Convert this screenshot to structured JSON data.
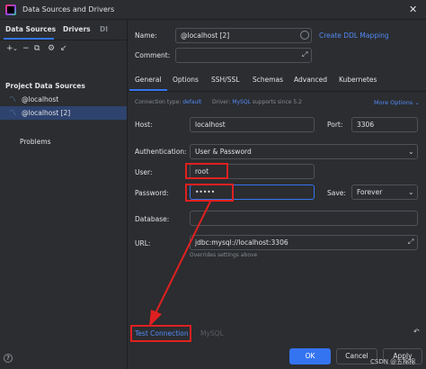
{
  "window": {
    "title": "Data Sources and Drivers",
    "close_icon": "close-icon"
  },
  "left": {
    "tabs": [
      "Data Sources",
      "Drivers",
      "DI"
    ],
    "toolbar_icons": [
      "add-icon",
      "remove-icon",
      "duplicate-icon",
      "settings-icon",
      "back-icon"
    ],
    "section_label": "Project Data Sources",
    "items": [
      {
        "label": "@localhost",
        "selected": false
      },
      {
        "label": "@localhost [2]",
        "selected": true
      }
    ],
    "problems_label": "Problems"
  },
  "header": {
    "name_label": "Name:",
    "name_value": "@localhost [2]",
    "create_ddl_link": "Create DDL Mapping",
    "comment_label": "Comment:"
  },
  "config_tabs": [
    "General",
    "Options",
    "SSH/SSL",
    "Schemas",
    "Advanced",
    "Kubernetes"
  ],
  "general": {
    "conn_type_label": "Connection type:",
    "conn_type_value": "default",
    "driver_label": "Driver:",
    "driver_value": "MySQL",
    "driver_note": "supports since 5.2",
    "more_options": "More Options",
    "host_label": "Host:",
    "host_value": "localhost",
    "port_label": "Port:",
    "port_value": "3306",
    "auth_label": "Authentication:",
    "auth_value": "User & Password",
    "user_label": "User:",
    "user_value": "root",
    "password_label": "Password:",
    "password_value": "•••••",
    "save_label": "Save:",
    "save_value": "Forever",
    "database_label": "Database:",
    "database_value": "",
    "url_label": "URL:",
    "url_value": "jdbc:mysql://localhost:3306",
    "url_note": "Overrides settings above"
  },
  "bottom": {
    "test_connection": "Test Connection",
    "driver_name": "MySQL",
    "ok": "OK",
    "cancel": "Cancel",
    "apply": "Apply"
  },
  "watermark": "CSDN @五棉棉",
  "colors": {
    "accent": "#3574f0",
    "annotation": "#e02020",
    "background": "#2b2d30"
  }
}
